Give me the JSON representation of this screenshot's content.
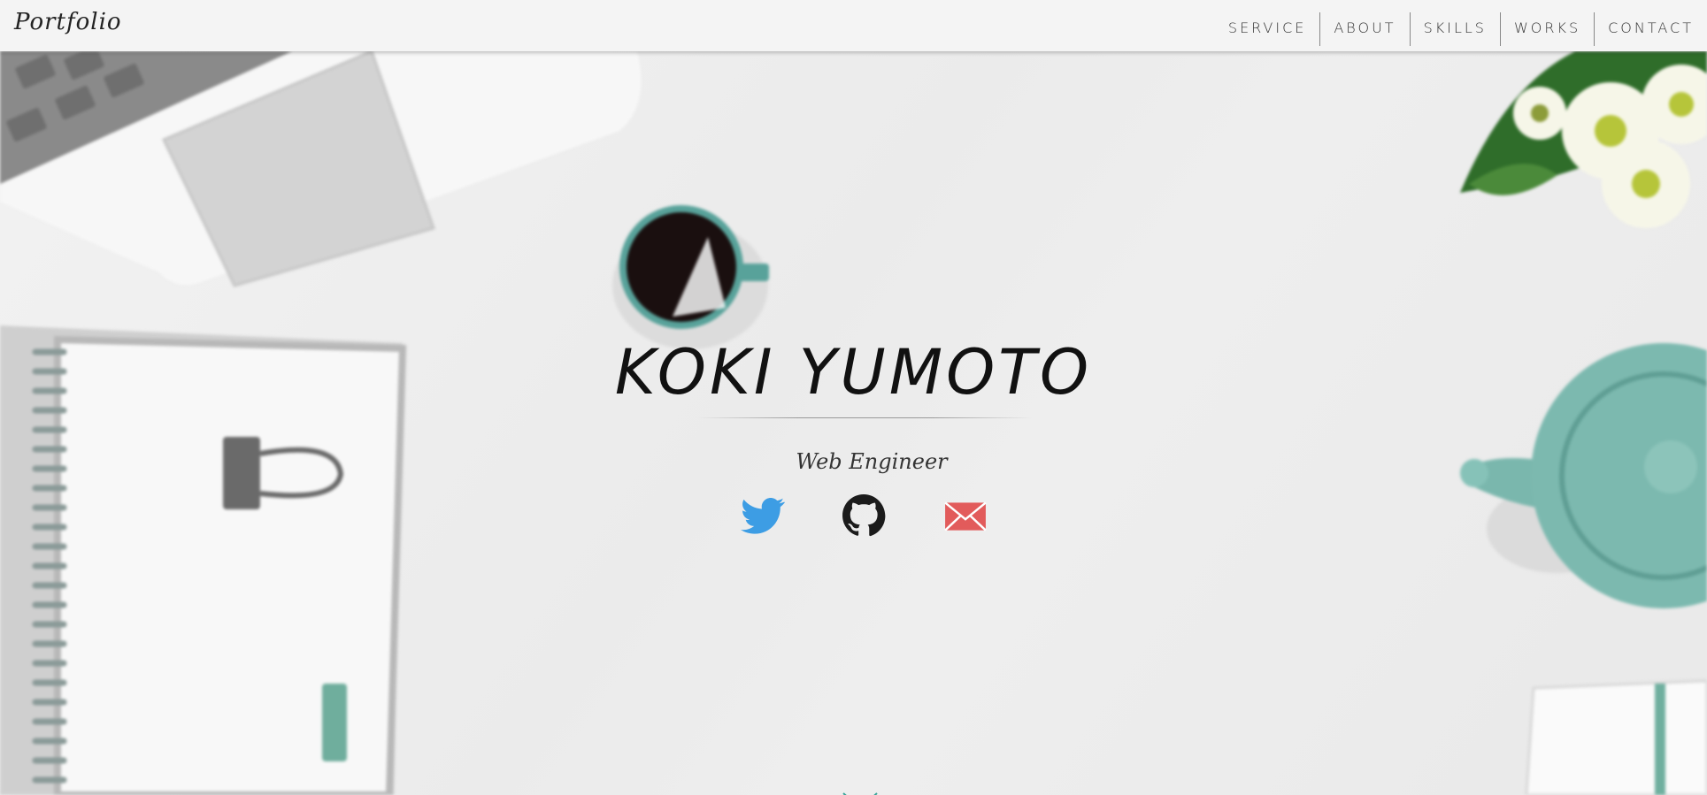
{
  "header": {
    "logo": "Portfolio",
    "nav": [
      {
        "label": "SERVICE"
      },
      {
        "label": "ABOUT"
      },
      {
        "label": "SKILLS"
      },
      {
        "label": "WORKS"
      },
      {
        "label": "CONTACT"
      }
    ]
  },
  "hero": {
    "name": "KOKI YUMOTO",
    "subtitle": "Web Engineer",
    "social": [
      {
        "icon": "twitter-icon",
        "color": "#3d9de4"
      },
      {
        "icon": "github-icon",
        "color": "#1b1b1b"
      },
      {
        "icon": "mail-icon",
        "color": "#e25b5b"
      }
    ],
    "scroll_icon": "chevron-down-icon",
    "accent": "#3aa59a"
  }
}
